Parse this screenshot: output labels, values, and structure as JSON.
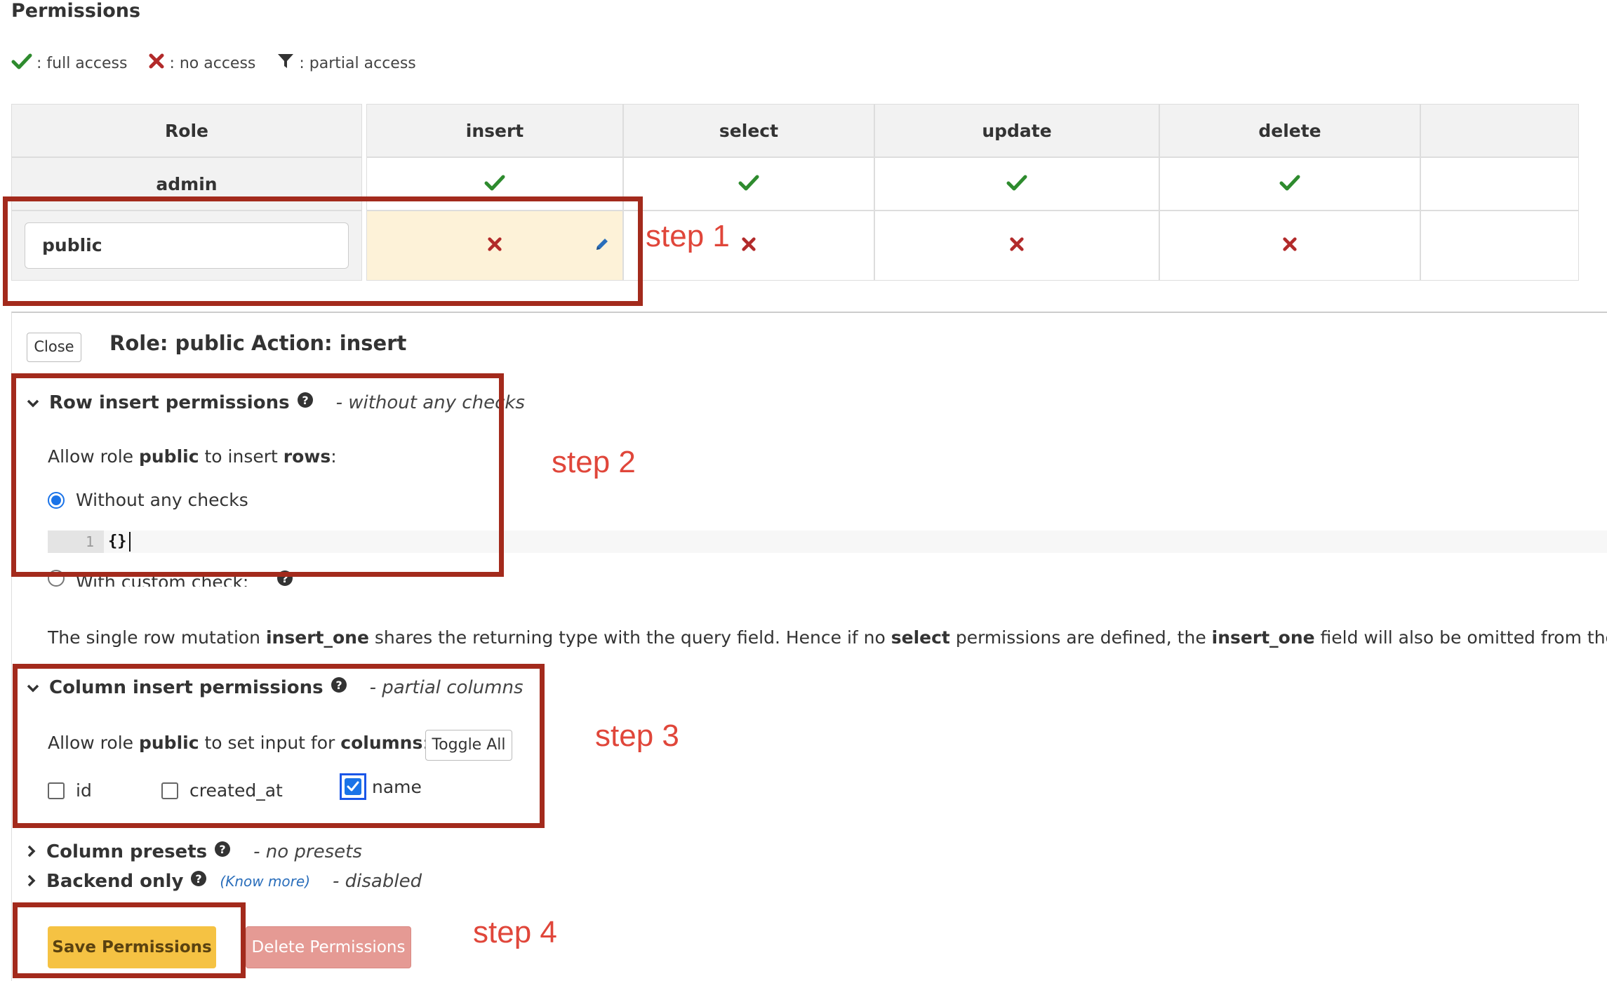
{
  "page": {
    "title": "Permissions",
    "legend": [
      {
        "icon": "check-icon",
        "label": ": full access"
      },
      {
        "icon": "cross-icon",
        "label": ": no access"
      },
      {
        "icon": "filter-icon",
        "label": ": partial access"
      }
    ]
  },
  "table": {
    "headers": [
      "Role",
      "insert",
      "select",
      "update",
      "delete",
      ""
    ],
    "rows": [
      {
        "role": "admin",
        "insert": "full",
        "select": "full",
        "update": "full",
        "delete": "full"
      },
      {
        "role": "public",
        "insert": "none",
        "select": "none",
        "update": "none",
        "delete": "none"
      }
    ],
    "public_role_value": "public"
  },
  "panel": {
    "close_label": "Close",
    "role_heading": "Role: public",
    "action_heading": "Action: insert",
    "row_section": {
      "title": "Row insert permissions",
      "status": "- without any checks",
      "allow_prefix": "Allow role ",
      "allow_role": "public",
      "allow_middle": " to insert ",
      "allow_target": "rows",
      "allow_suffix": ":",
      "option_without": "Without any checks",
      "option_custom": "With custom check:",
      "code_line_number": "1",
      "code_text": "{}"
    },
    "note": {
      "p1": "The single row mutation ",
      "b1": "insert_one",
      "p2": " shares the returning type with the query field. Hence if no ",
      "b2": "select",
      "p3": " permissions are defined, the ",
      "b3": "insert_one",
      "p4": " field will also be omitted from the GraphQL sch"
    },
    "column_section": {
      "title": "Column insert permissions",
      "status": "- partial columns",
      "allow_prefix": "Allow role ",
      "allow_role": "public",
      "allow_middle": " to set input for ",
      "allow_target": "columns",
      "allow_suffix": ":",
      "toggle_all_label": "Toggle All",
      "columns": [
        {
          "name": "id",
          "checked": false
        },
        {
          "name": "created_at",
          "checked": false
        },
        {
          "name": "name",
          "checked": true
        }
      ]
    },
    "presets_section": {
      "title": "Column presets",
      "status": "- no presets"
    },
    "backend_section": {
      "title": "Backend only",
      "know_more": "(Know more)",
      "status": "- disabled"
    },
    "save_label": "Save Permissions",
    "delete_label": "Delete Permissions"
  },
  "annotations": {
    "step1": "step 1",
    "step2": "step 2",
    "step3": "step 3",
    "step4": "step 4",
    "color": "#a32a1c",
    "text_color": "#e0463a"
  },
  "colors": {
    "check": "#2e8b2e",
    "cross": "#b22a2a",
    "highlight_cell": "#fdf2d8",
    "save_button": "#f5c243",
    "delete_button": "#e59a94",
    "accent": "#1a73e8"
  }
}
